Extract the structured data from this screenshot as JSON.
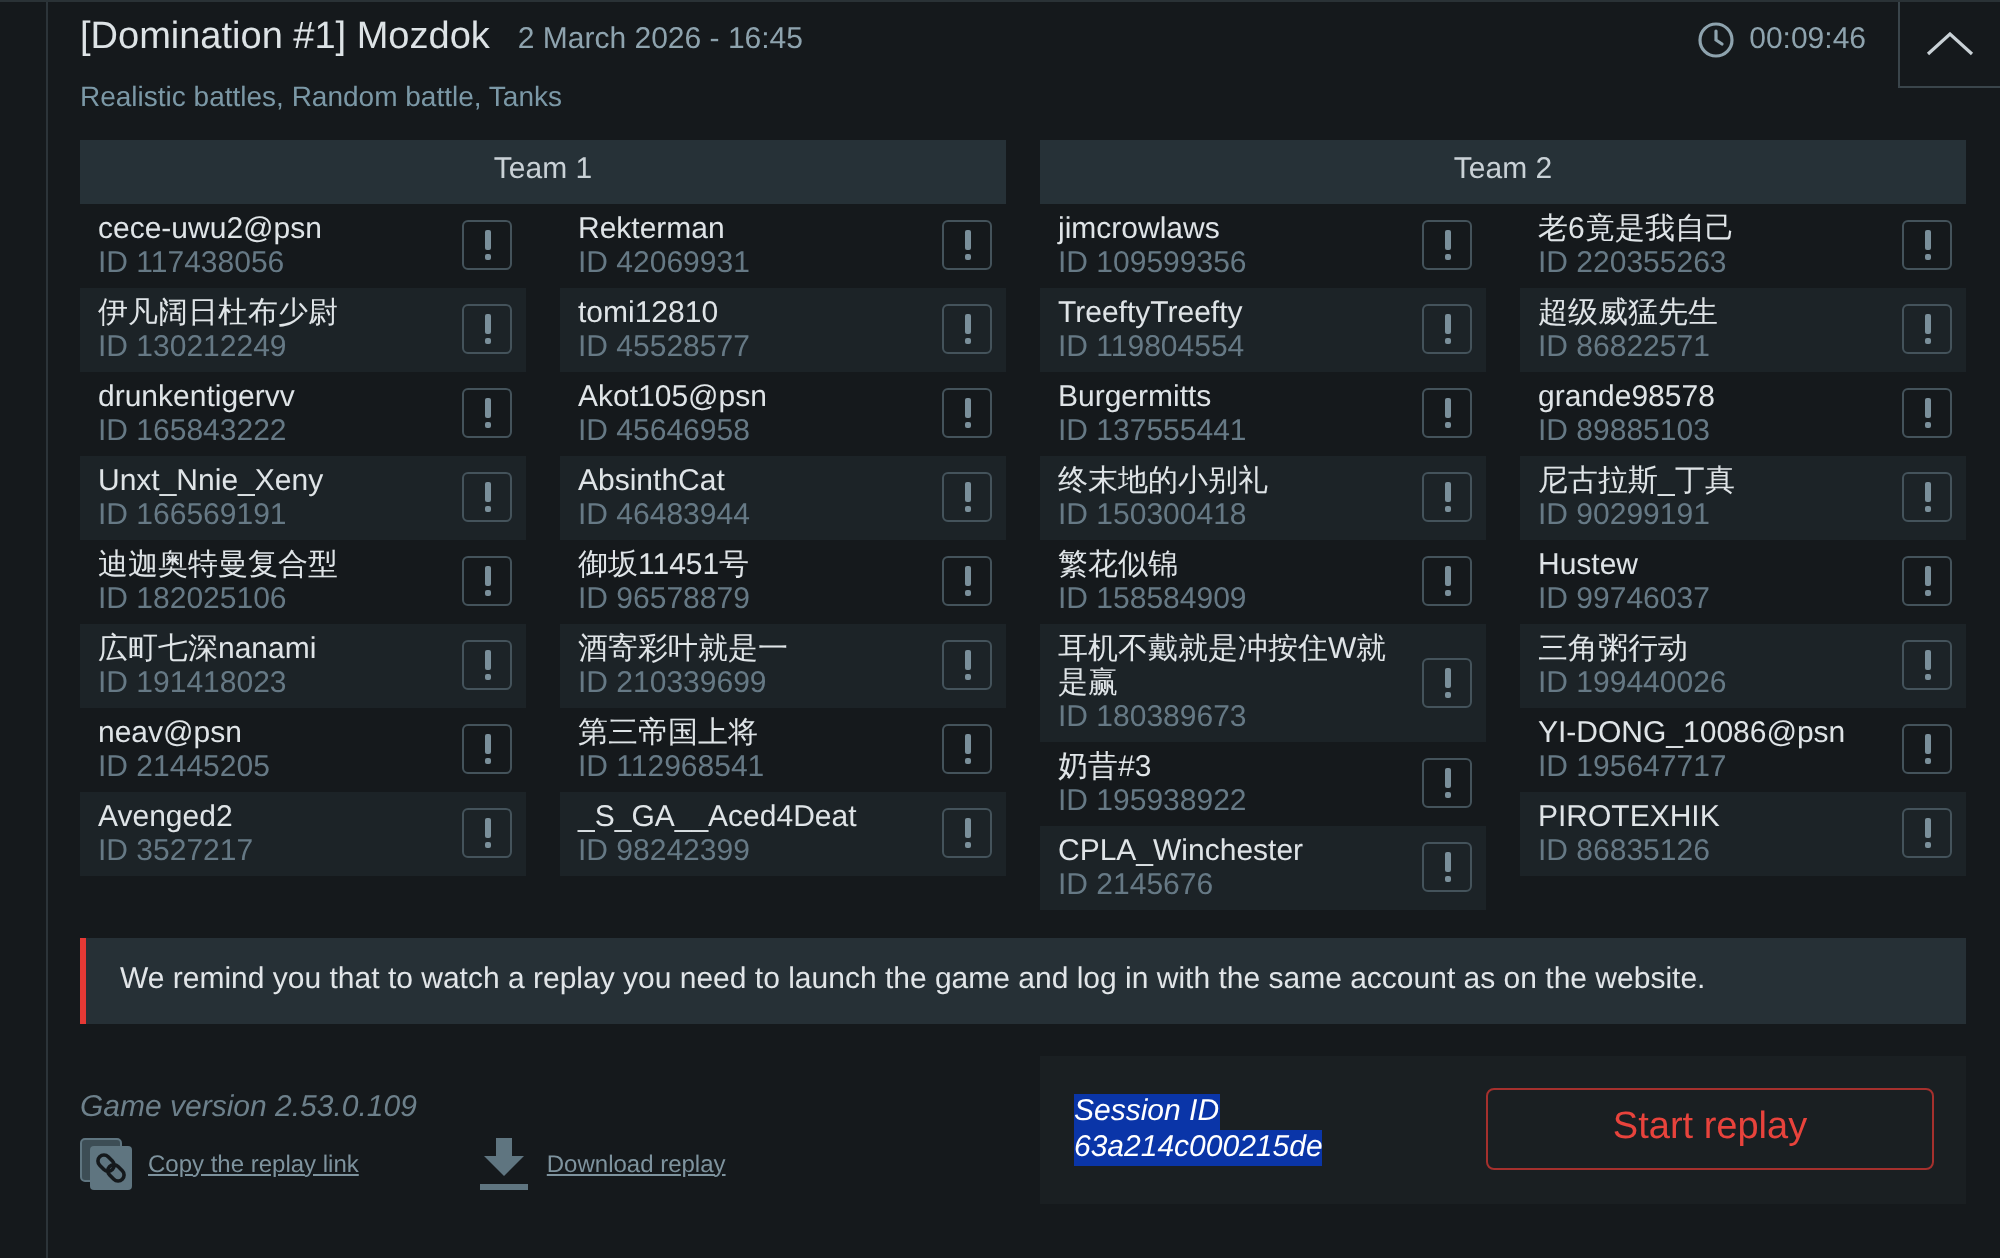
{
  "match": {
    "title": "[Domination #1] Mozdok",
    "date": "2 March 2026 - 16:45",
    "mode": "Realistic battles, Random battle, Tanks",
    "duration": "00:09:46"
  },
  "teams": [
    {
      "name": "Team 1",
      "columns": [
        {
          "players": [
            {
              "name": "cece-uwu2@psn",
              "id": "ID 117438056"
            },
            {
              "name": "伊凡阔日杜布少尉",
              "id": "ID 130212249"
            },
            {
              "name": "drunkentigervv",
              "id": "ID 165843222"
            },
            {
              "name": "Unxt_Nnie_Xeny",
              "id": "ID 166569191"
            },
            {
              "name": "迪迦奥特曼复合型",
              "id": "ID 182025106"
            },
            {
              "name": "広町七深nanami",
              "id": "ID 191418023"
            },
            {
              "name": "neav@psn",
              "id": "ID 21445205"
            },
            {
              "name": "Avenged2",
              "id": "ID 3527217"
            }
          ]
        },
        {
          "players": [
            {
              "name": "Rekterman",
              "id": "ID 42069931"
            },
            {
              "name": "tomi12810",
              "id": "ID 45528577"
            },
            {
              "name": "Akot105@psn",
              "id": "ID 45646958"
            },
            {
              "name": "AbsinthCat",
              "id": "ID 46483944"
            },
            {
              "name": "御坂11451号",
              "id": "ID 96578879"
            },
            {
              "name": "酒寄彩叶就是一",
              "id": "ID 210339699"
            },
            {
              "name": "第三帝国上将",
              "id": "ID 112968541"
            },
            {
              "name": "_S_GA__Aced4Deat",
              "id": "ID 98242399"
            }
          ]
        }
      ]
    },
    {
      "name": "Team 2",
      "columns": [
        {
          "players": [
            {
              "name": "jimcrowlaws",
              "id": "ID 109599356"
            },
            {
              "name": "TreeftyTreefty",
              "id": "ID 119804554"
            },
            {
              "name": "Burgermitts",
              "id": "ID 137555441"
            },
            {
              "name": "终末地的小别礼",
              "id": "ID 150300418"
            },
            {
              "name": "繁花似锦",
              "id": "ID 158584909"
            },
            {
              "name": "耳机不戴就是冲按住W就是赢",
              "id": "ID 180389673"
            },
            {
              "name": "奶昔#3",
              "id": "ID 195938922"
            },
            {
              "name": "CPLA_Winchester",
              "id": "ID 2145676"
            }
          ]
        },
        {
          "players": [
            {
              "name": "老6竟是我自己",
              "id": "ID 220355263"
            },
            {
              "name": "超级威猛先生",
              "id": "ID 86822571"
            },
            {
              "name": "grande98578",
              "id": "ID 89885103"
            },
            {
              "name": "尼古拉斯_丁真",
              "id": "ID 90299191"
            },
            {
              "name": "Hustew",
              "id": "ID 99746037"
            },
            {
              "name": "三角粥行动",
              "id": "ID 199440026"
            },
            {
              "name": "YI-DONG_10086@psn",
              "id": "ID 195647717"
            },
            {
              "name": "PIROTEXHIK",
              "id": "ID 86835126"
            }
          ]
        }
      ]
    }
  ],
  "notice": "We remind you that to watch a replay you need to launch the game and log in with the same account as on the website.",
  "footer": {
    "game_version": "Game version 2.53.0.109",
    "links": [
      {
        "kind": "copy",
        "label": "Copy the replay link"
      },
      {
        "kind": "download",
        "label": "Download replay"
      }
    ]
  },
  "session": {
    "label": "Session ID",
    "value": "63a214c000215de",
    "highlighted": true
  },
  "start_button": "Start replay"
}
